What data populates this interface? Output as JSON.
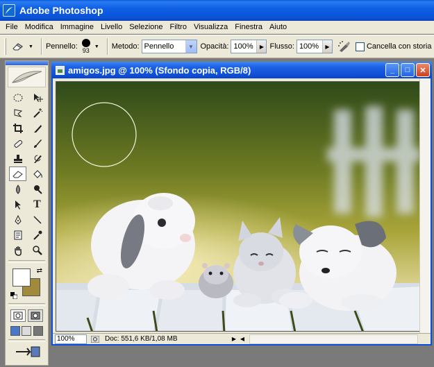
{
  "app": {
    "title": "Adobe Photoshop"
  },
  "menu": [
    "File",
    "Modifica",
    "Immagine",
    "Livello",
    "Selezione",
    "Filtro",
    "Visualizza",
    "Finestra",
    "Aiuto"
  ],
  "options": {
    "brush_label": "Pennello:",
    "brush_size": "93",
    "method_label": "Metodo:",
    "method_value": "Pennello",
    "opacity_label": "Opacità:",
    "opacity_value": "100%",
    "flow_label": "Flusso:",
    "flow_value": "100%",
    "erase_history_label": "Cancella con storia"
  },
  "colors": {
    "foreground": "#ffffff",
    "background": "#a08a3c",
    "title_bar": "#0a52d6"
  },
  "document": {
    "title": "amigos.jpg @ 100% (Sfondo copia, RGB/8)",
    "zoom": "100%",
    "doc_info": "Doc: 551,6 KB/1,08 MB"
  },
  "tools": [
    "marquee-icon",
    "move-icon",
    "lasso-icon",
    "magic-wand-icon",
    "crop-icon",
    "slice-icon",
    "healing-brush-icon",
    "brush-icon",
    "clone-stamp-icon",
    "history-brush-icon",
    "eraser-icon",
    "paint-bucket-icon",
    "blur-icon",
    "dodge-icon",
    "path-selection-icon",
    "type-icon",
    "pen-icon",
    "line-icon",
    "notes-icon",
    "eyedropper-icon",
    "hand-icon",
    "zoom-icon"
  ]
}
